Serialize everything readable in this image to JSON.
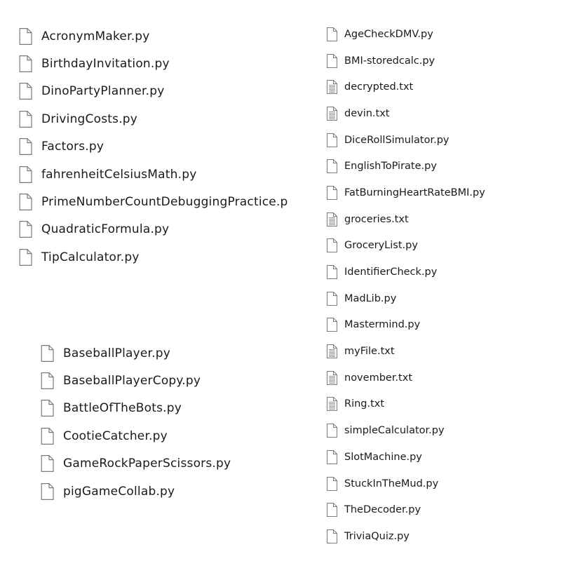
{
  "groups": [
    {
      "id": "top-left",
      "files": [
        {
          "name": "AcronymMaker.py",
          "icon": "blank-file-icon"
        },
        {
          "name": "BirthdayInvitation.py",
          "icon": "blank-file-icon"
        },
        {
          "name": "DinoPartyPlanner.py",
          "icon": "blank-file-icon"
        },
        {
          "name": "DrivingCosts.py",
          "icon": "blank-file-icon"
        },
        {
          "name": "Factors.py",
          "icon": "blank-file-icon"
        },
        {
          "name": "fahrenheitCelsiusMath.py",
          "icon": "blank-file-icon"
        },
        {
          "name": "PrimeNumberCountDebuggingPractice.p",
          "icon": "blank-file-icon"
        },
        {
          "name": "QuadraticFormula.py",
          "icon": "blank-file-icon"
        },
        {
          "name": "TipCalculator.py",
          "icon": "blank-file-icon"
        }
      ]
    },
    {
      "id": "bottom-left",
      "files": [
        {
          "name": "BaseballPlayer.py",
          "icon": "blank-file-icon"
        },
        {
          "name": "BaseballPlayerCopy.py",
          "icon": "blank-file-icon"
        },
        {
          "name": "BattleOfTheBots.py",
          "icon": "blank-file-icon"
        },
        {
          "name": "CootieCatcher.py",
          "icon": "blank-file-icon"
        },
        {
          "name": "GameRockPaperScissors.py",
          "icon": "blank-file-icon"
        },
        {
          "name": "pigGameCollab.py",
          "icon": "blank-file-icon"
        }
      ]
    },
    {
      "id": "right",
      "files": [
        {
          "name": "AgeCheckDMV.py",
          "icon": "blank-file-icon"
        },
        {
          "name": "BMI-storedcalc.py",
          "icon": "blank-file-icon"
        },
        {
          "name": "decrypted.txt",
          "icon": "text-file-icon"
        },
        {
          "name": "devin.txt",
          "icon": "text-file-icon"
        },
        {
          "name": "DiceRollSimulator.py",
          "icon": "blank-file-icon"
        },
        {
          "name": "EnglishToPirate.py",
          "icon": "blank-file-icon"
        },
        {
          "name": "FatBurningHeartRateBMI.py",
          "icon": "blank-file-icon"
        },
        {
          "name": "groceries.txt",
          "icon": "text-file-icon"
        },
        {
          "name": "GroceryList.py",
          "icon": "blank-file-icon"
        },
        {
          "name": "IdentifierCheck.py",
          "icon": "blank-file-icon"
        },
        {
          "name": "MadLib.py",
          "icon": "blank-file-icon"
        },
        {
          "name": "Mastermind.py",
          "icon": "blank-file-icon"
        },
        {
          "name": "myFile.txt",
          "icon": "text-file-icon"
        },
        {
          "name": "november.txt",
          "icon": "text-file-icon"
        },
        {
          "name": "Ring.txt",
          "icon": "text-file-icon"
        },
        {
          "name": "simpleCalculator.py",
          "icon": "blank-file-icon"
        },
        {
          "name": "SlotMachine.py",
          "icon": "blank-file-icon"
        },
        {
          "name": "StuckInTheMud.py",
          "icon": "blank-file-icon"
        },
        {
          "name": "TheDecoder.py",
          "icon": "blank-file-icon"
        },
        {
          "name": "TriviaQuiz.py",
          "icon": "blank-file-icon"
        }
      ]
    }
  ]
}
